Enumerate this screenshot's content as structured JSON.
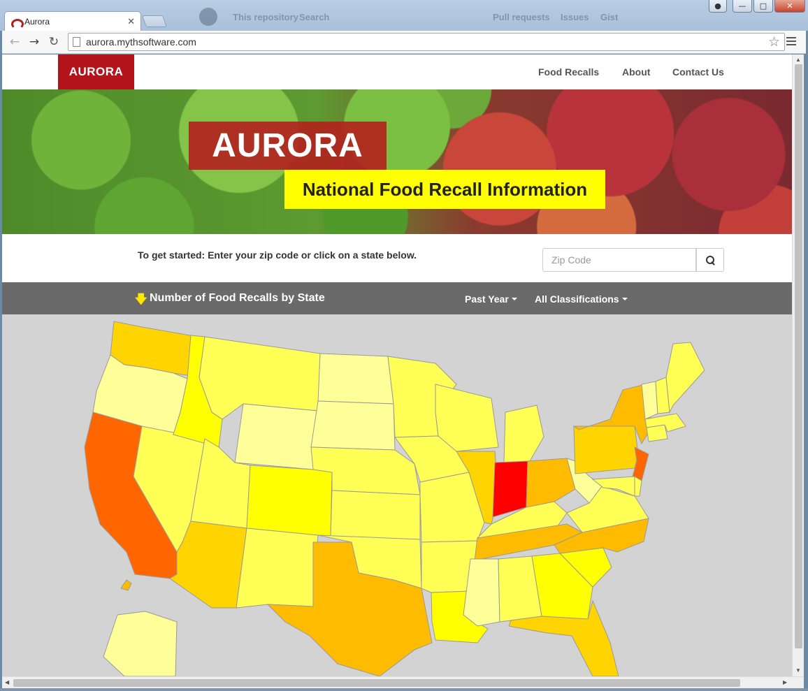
{
  "browser": {
    "tab_title": "Aurora",
    "url": "aurora.mythsoftware.com",
    "background_page": {
      "placeholder": "This repository",
      "search_label": "Search",
      "links": [
        "Pull requests",
        "Issues",
        "Gist"
      ]
    }
  },
  "site": {
    "brand": "AURORA",
    "nav": [
      "Food Recalls",
      "About",
      "Contact Us"
    ]
  },
  "hero": {
    "title": "AURORA",
    "subtitle": "National Food Recall Information"
  },
  "zip": {
    "instructions": "To get started: Enter your zip code or click on a state below.",
    "placeholder": "Zip Code"
  },
  "map_header": {
    "title": "Number of Food Recalls by State",
    "time_filter": "Past Year",
    "class_filter": "All Classifications"
  },
  "colors": {
    "brand_red": "#b3141b",
    "hero_yellow": "#ffff00",
    "map_bar": "#6a6a6a",
    "map_background": "#d3d3d3",
    "very_high": "#ff0000",
    "high": "#ff6600",
    "medium_high": "#ffbb00",
    "medium": "#ffd400",
    "low": "#ffff00",
    "lower": "#ffff55",
    "lowest": "#ffff99"
  },
  "map_states": [
    {
      "name": "Washington",
      "level": "medium"
    },
    {
      "name": "Oregon",
      "level": "lowest"
    },
    {
      "name": "California",
      "level": "high"
    },
    {
      "name": "Nevada",
      "level": "lower"
    },
    {
      "name": "Idaho",
      "level": "low"
    },
    {
      "name": "Montana",
      "level": "lower"
    },
    {
      "name": "Wyoming",
      "level": "lowest"
    },
    {
      "name": "Utah",
      "level": "lower"
    },
    {
      "name": "Arizona",
      "level": "medium"
    },
    {
      "name": "Colorado",
      "level": "low"
    },
    {
      "name": "New Mexico",
      "level": "lower"
    },
    {
      "name": "North Dakota",
      "level": "lowest"
    },
    {
      "name": "South Dakota",
      "level": "lowest"
    },
    {
      "name": "Nebraska",
      "level": "lower"
    },
    {
      "name": "Kansas",
      "level": "lower"
    },
    {
      "name": "Oklahoma",
      "level": "lower"
    },
    {
      "name": "Texas",
      "level": "medium_high"
    },
    {
      "name": "Minnesota",
      "level": "lower"
    },
    {
      "name": "Iowa",
      "level": "lower"
    },
    {
      "name": "Missouri",
      "level": "lower"
    },
    {
      "name": "Arkansas",
      "level": "lower"
    },
    {
      "name": "Louisiana",
      "level": "low"
    },
    {
      "name": "Wisconsin",
      "level": "lower"
    },
    {
      "name": "Illinois",
      "level": "medium"
    },
    {
      "name": "Michigan",
      "level": "lower"
    },
    {
      "name": "Indiana",
      "level": "very_high"
    },
    {
      "name": "Ohio",
      "level": "medium_high"
    },
    {
      "name": "Kentucky",
      "level": "lower"
    },
    {
      "name": "Tennessee",
      "level": "medium_high"
    },
    {
      "name": "Mississippi",
      "level": "lowest"
    },
    {
      "name": "Alabama",
      "level": "lower"
    },
    {
      "name": "Georgia",
      "level": "low"
    },
    {
      "name": "Florida",
      "level": "medium"
    },
    {
      "name": "South Carolina",
      "level": "low"
    },
    {
      "name": "North Carolina",
      "level": "medium_high"
    },
    {
      "name": "Virginia",
      "level": "lower"
    },
    {
      "name": "West Virginia",
      "level": "lowest"
    },
    {
      "name": "Pennsylvania",
      "level": "medium"
    },
    {
      "name": "New York",
      "level": "medium_high"
    },
    {
      "name": "New Jersey",
      "level": "high"
    },
    {
      "name": "Maryland",
      "level": "lower"
    },
    {
      "name": "Delaware",
      "level": "lower"
    },
    {
      "name": "Connecticut",
      "level": "lower"
    },
    {
      "name": "Massachusetts",
      "level": "lower"
    },
    {
      "name": "Vermont",
      "level": "lowest"
    },
    {
      "name": "New Hampshire",
      "level": "lower"
    },
    {
      "name": "Maine",
      "level": "lower"
    },
    {
      "name": "Alaska",
      "level": "lowest"
    },
    {
      "name": "Hawaii",
      "level": "medium_high"
    }
  ]
}
